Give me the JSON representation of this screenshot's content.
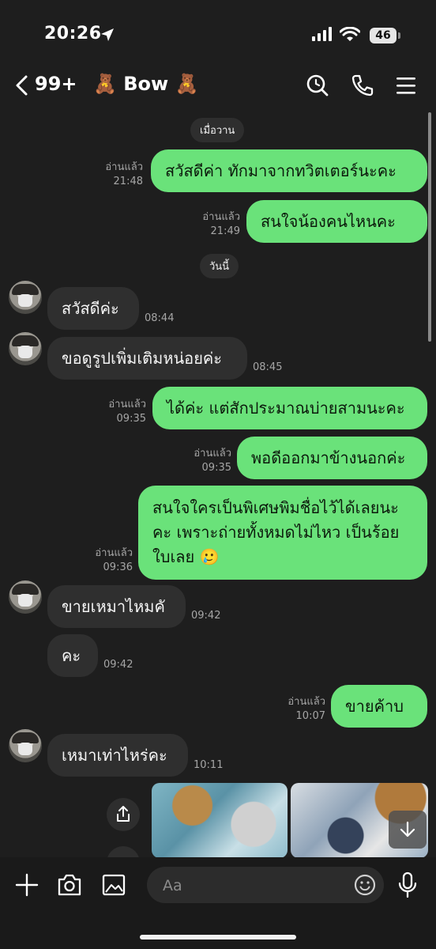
{
  "status_bar": {
    "time": "20:26",
    "battery": "46"
  },
  "header": {
    "unread_count": "99+",
    "contact_name": "🧸 Bow 🧸"
  },
  "date_separators": [
    "เมื่อวาน",
    "วันนี้"
  ],
  "messages": [
    {
      "dir": "out",
      "text": "สวัสดีค่า ทักมาจากทวิตเตอร์นะคะ",
      "read": "อ่านแล้ว",
      "time": "21:48"
    },
    {
      "dir": "out",
      "text": "สนใจน้องคนไหนคะ",
      "read": "อ่านแล้ว",
      "time": "21:49"
    },
    {
      "dir": "in",
      "text": "สวัสดีค่ะ",
      "time": "08:44"
    },
    {
      "dir": "in",
      "text": "ขอดูรูปเพิ่มเติมหน่อยค่ะ",
      "time": "08:45"
    },
    {
      "dir": "out",
      "text": "ได้ค่ะ แต่สักประมาณบ่ายสามนะคะ",
      "read": "อ่านแล้ว",
      "time": "09:35"
    },
    {
      "dir": "out",
      "text": "พอดีออกมาข้างนอกค่ะ",
      "read": "อ่านแล้ว",
      "time": "09:35"
    },
    {
      "dir": "out",
      "text": "สนใจใครเป็นพิเศษพิมชื่อไว้ได้เลยนะคะ เพราะถ่ายทั้งหมดไม่ไหว เป็นร้อยใบเลย 🥲",
      "read": "อ่านแล้ว",
      "time": "09:36"
    },
    {
      "dir": "in",
      "text": "ขายเหมาไหมคั",
      "time": "09:42"
    },
    {
      "dir": "in",
      "text": "คะ",
      "time": "09:42"
    },
    {
      "dir": "out",
      "text": "ขายค้าบ",
      "read": "อ่านแล้ว",
      "time": "10:07"
    },
    {
      "dir": "in",
      "text": "เหมาเท่าไหร่คะ",
      "time": "10:11"
    }
  ],
  "input": {
    "placeholder": "Aa"
  },
  "colors": {
    "background": "#1e1e1e",
    "outgoing_bubble": "#6ae27a",
    "incoming_bubble": "#2f2f2f"
  },
  "icons": [
    "location-arrow-icon",
    "signal-icon",
    "wifi-icon",
    "back-chevron-icon",
    "search-icon",
    "phone-icon",
    "menu-icon",
    "share-icon",
    "arrow-down-icon",
    "plus-icon",
    "camera-icon",
    "image-icon",
    "emoji-icon",
    "microphone-icon"
  ]
}
